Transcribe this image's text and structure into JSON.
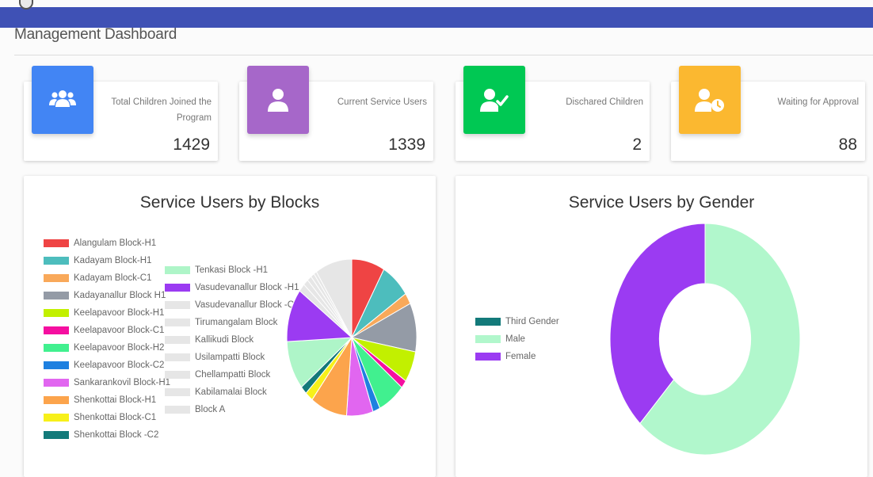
{
  "page": {
    "title": "Management Dashboard"
  },
  "colors": {
    "topbar": "#3f51b5"
  },
  "stats": [
    {
      "label": "Total Children Joined the Program",
      "value": "1429",
      "color": "#4285f4",
      "icon": "users-group-icon"
    },
    {
      "label": "Current Service Users",
      "value": "1339",
      "color": "#a667c9",
      "icon": "user-icon"
    },
    {
      "label": "Dischared Children",
      "value": "2",
      "color": "#00c853",
      "icon": "user-check-icon"
    },
    {
      "label": "Waiting for Approval",
      "value": "88",
      "color": "#fbb830",
      "icon": "user-clock-icon"
    }
  ],
  "blocks_chart": {
    "title": "Service Users by Blocks",
    "legend_col1": [
      {
        "label": "Alangulam Block-H1",
        "color": "#ef4444"
      },
      {
        "label": "Kadayam Block-H1",
        "color": "#4dbdbd"
      },
      {
        "label": "Kadayam Block-C1",
        "color": "#f9a95a"
      },
      {
        "label": "Kadayanallur Block H1",
        "color": "#949ba6"
      },
      {
        "label": "Keelapavoor Block-H1",
        "color": "#c2f000"
      },
      {
        "label": "Keelapavoor Block-C1",
        "color": "#f50fa0"
      },
      {
        "label": "Keelapavoor Block-H2",
        "color": "#41f08f"
      },
      {
        "label": "Keelapavoor Block-C2",
        "color": "#1e80e0"
      },
      {
        "label": "Sankarankovil Block-H1",
        "color": "#e166f0"
      },
      {
        "label": "Shenkottai Block-H1",
        "color": "#fca44c"
      },
      {
        "label": "Shenkottai Block-C1",
        "color": "#f7f01a"
      },
      {
        "label": "Shenkottai Block -C2",
        "color": "#137a7a"
      }
    ],
    "legend_col2": [
      {
        "label": "Tenkasi Block -H1",
        "color": "#aef5c8"
      },
      {
        "label": "Vasudevanallur Block -H1",
        "color": "#9b3bf2"
      },
      {
        "label": "Vasudevanallur Block -C1",
        "color": "#e6e6e6"
      },
      {
        "label": "Tirumangalam Block",
        "color": "#e6e6e6"
      },
      {
        "label": "Kallikudi Block",
        "color": "#e6e6e6"
      },
      {
        "label": "Usilampatti Block",
        "color": "#e6e6e6"
      },
      {
        "label": "Chellampatti Block",
        "color": "#e6e6e6"
      },
      {
        "label": "Kabilamalai Block",
        "color": "#e6e6e6"
      },
      {
        "label": "Block A",
        "color": "#e6e6e6"
      }
    ],
    "chart_data": {
      "type": "pie",
      "values": [
        90,
        80,
        25,
        110,
        70,
        18,
        75,
        20,
        72,
        100,
        22,
        18,
        110,
        120,
        18,
        14,
        12,
        10,
        8,
        100
      ],
      "colors": [
        "#ef4444",
        "#4dbdbd",
        "#f9a95a",
        "#949ba6",
        "#c2f000",
        "#f50fa0",
        "#41f08f",
        "#1e80e0",
        "#e166f0",
        "#fca44c",
        "#f7f01a",
        "#137a7a",
        "#aef5c8",
        "#9b3bf2",
        "#e6e6e6",
        "#e6e6e6",
        "#e6e6e6",
        "#e6e6e6",
        "#e6e6e6",
        "#e6e6e6"
      ]
    }
  },
  "gender_chart": {
    "title": "Service Users by Gender",
    "legend": [
      {
        "label": "Third Gender",
        "color": "#137a7a"
      },
      {
        "label": "Male",
        "color": "#b1f7cc"
      },
      {
        "label": "Female",
        "color": "#9b3bf2"
      }
    ],
    "chart_data": {
      "type": "pie",
      "categories": [
        "Third Gender",
        "Male",
        "Female"
      ],
      "values": [
        0,
        62,
        38
      ],
      "colors": [
        "#137a7a",
        "#b1f7cc",
        "#9b3bf2"
      ]
    }
  }
}
